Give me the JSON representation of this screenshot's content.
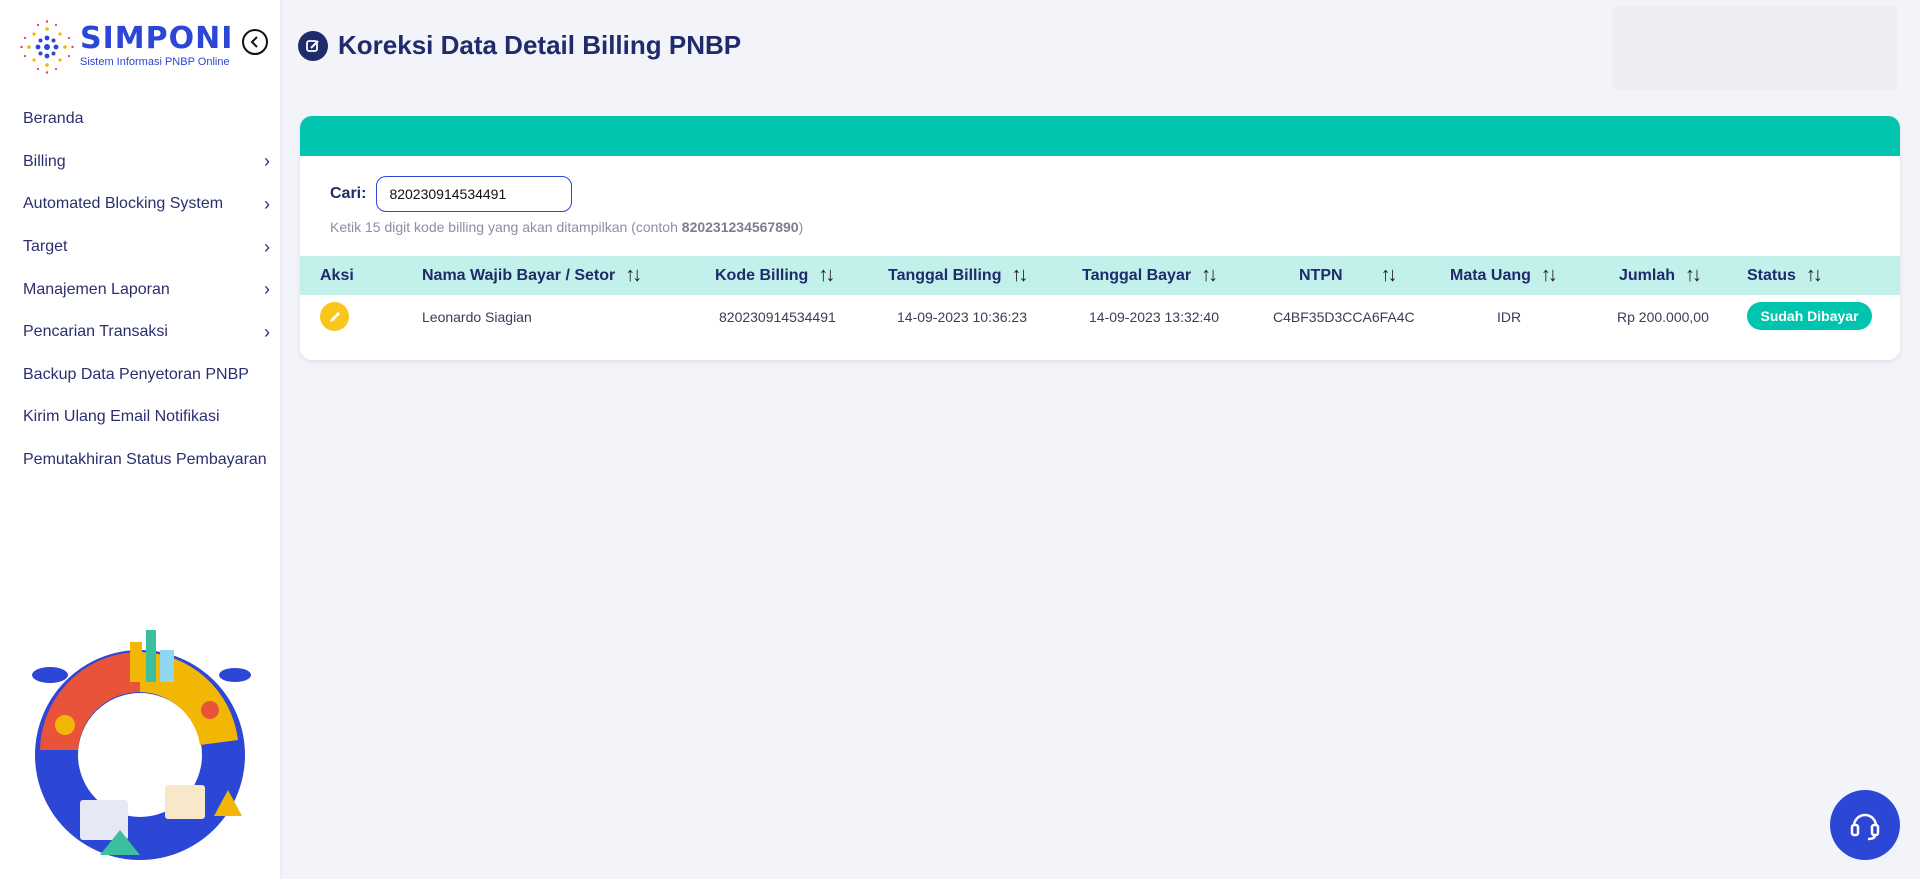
{
  "brand": {
    "name": "SIMPONI",
    "subtitle": "Sistem Informasi PNBP Online"
  },
  "sidebar": {
    "items": [
      {
        "label": "Beranda",
        "has_submenu": false
      },
      {
        "label": "Billing",
        "has_submenu": true
      },
      {
        "label": "Automated Blocking System",
        "has_submenu": true
      },
      {
        "label": "Target",
        "has_submenu": true
      },
      {
        "label": "Manajemen Laporan",
        "has_submenu": true
      },
      {
        "label": "Pencarian Transaksi",
        "has_submenu": true
      },
      {
        "label": "Backup Data Penyetoran PNBP",
        "has_submenu": false
      },
      {
        "label": "Kirim Ulang Email Notifikasi",
        "has_submenu": false
      },
      {
        "label": "Pemutakhiran Status Pembayaran",
        "has_submenu": false
      }
    ]
  },
  "page": {
    "title": "Koreksi Data Detail Billing PNBP"
  },
  "search": {
    "label": "Cari:",
    "value": "820230914534491",
    "hint_prefix": "Ketik 15 digit kode billing yang akan ditampilkan (contoh ",
    "hint_example": "820231234567890",
    "hint_suffix": ")"
  },
  "table": {
    "columns": [
      "Aksi",
      "Nama Wajib Bayar / Setor",
      "Kode Billing",
      "Tanggal Billing",
      "Tanggal Bayar",
      "NTPN",
      "Mata Uang",
      "Jumlah",
      "Status"
    ],
    "rows": [
      {
        "nama": "Leonardo Siagian",
        "kode_billing": "820230914534491",
        "tanggal_billing": "14-09-2023 10:36:23",
        "tanggal_bayar": "14-09-2023 13:32:40",
        "ntpn": "C4BF35D3CCA6FA4C",
        "mata_uang": "IDR",
        "jumlah": "Rp 200.000,00",
        "status": "Sudah Dibayar"
      }
    ]
  },
  "colors": {
    "accent": "#00c4ae",
    "brand": "#2c46d6",
    "title": "#1f2b6b",
    "edit": "#fac51c"
  }
}
